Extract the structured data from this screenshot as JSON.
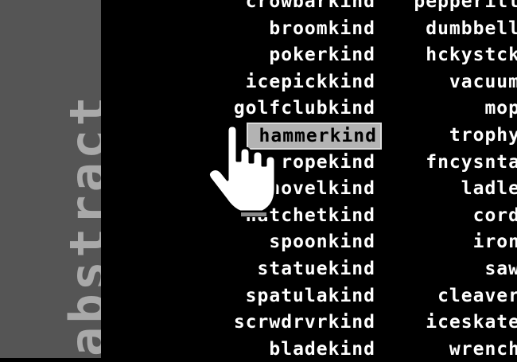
{
  "sidebar": {
    "title": "abstract"
  },
  "list_left": [
    "crowbarkind",
    "broomkind",
    "pokerkind",
    "icepickkind",
    "golfclubkind",
    "hammerkind",
    "ropekind",
    "shovelkind",
    "hatchetkind",
    "spoonkind",
    "statuekind",
    "spatulakind",
    "scrwdrvrkind",
    "bladekind"
  ],
  "list_right": [
    "pepperill",
    "dumbbell",
    "hckystck",
    "vacuum",
    "mop",
    "trophy",
    "fncysnta",
    "ladle",
    "cord",
    "iron",
    "saw",
    "cleaver",
    "iceskate",
    "wrench"
  ],
  "selected_item": "hammerkind",
  "colors": {
    "sidebar_bg": "#555555",
    "title_text": "#a9a9a9",
    "list_text": "#ffffff",
    "selection_bg": "#b3b3b3"
  },
  "cursor": {
    "icon": "hand-pointer-icon"
  }
}
